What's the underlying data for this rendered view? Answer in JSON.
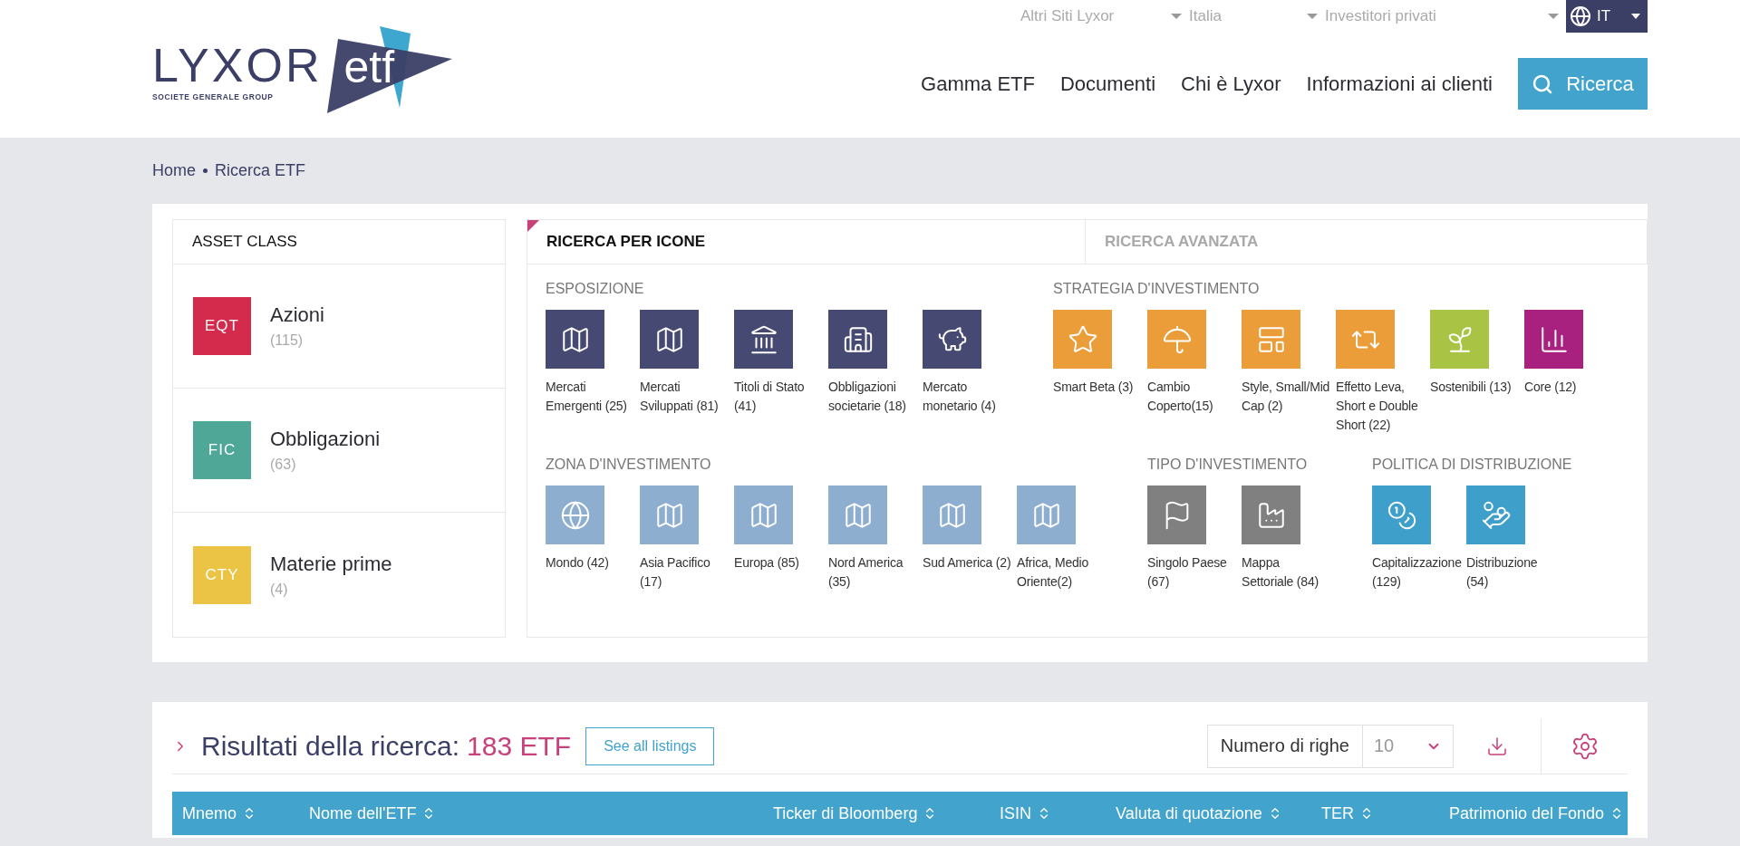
{
  "header": {
    "logo": {
      "name": "LYXOR",
      "tagline": "SOCIETE GENERALE GROUP",
      "mark": "etf"
    },
    "top_selects": [
      "Altri Siti Lyxor",
      "Italia",
      "Investitori privati"
    ],
    "language": "IT",
    "nav": [
      "Gamma ETF",
      "Documenti",
      "Chi è Lyxor",
      "Informazioni ai clienti"
    ],
    "search_button": "Ricerca"
  },
  "breadcrumb": [
    "Home",
    "Ricerca ETF"
  ],
  "asset_class": {
    "title": "ASSET CLASS",
    "items": [
      {
        "code": "EQT",
        "label": "Azioni",
        "count": "(115)",
        "color": "#d42a4c"
      },
      {
        "code": "FIC",
        "label": "Obbligazioni",
        "count": "(63)",
        "color": "#4fa797"
      },
      {
        "code": "CTY",
        "label": "Materie prime",
        "count": "(4)",
        "color": "#ebc445"
      }
    ]
  },
  "search_tabs": [
    {
      "label": "RICERCA PER ICONE",
      "selected": true
    },
    {
      "label": "RICERCA AVANZATA",
      "selected": false
    }
  ],
  "icon_rows": [
    [
      {
        "title": "ESPOSIZIONE",
        "tiles": [
          {
            "label": "Mercati Emergenti (25)",
            "color": "#464a73"
          },
          {
            "label": "Mercati Sviluppati (81)",
            "color": "#464a73"
          },
          {
            "label": "Titoli di Stato (41)",
            "color": "#464a73"
          },
          {
            "label": "Obbligazioni societarie (18)",
            "color": "#464a73"
          },
          {
            "label": "Mercato monetario (4)",
            "color": "#464a73"
          }
        ]
      },
      {
        "title": "STRATEGIA D'INVESTIMENTO",
        "tiles": [
          {
            "label": "Smart Beta (3)",
            "color": "#eb9d3a"
          },
          {
            "label": "Cambio Coperto(15)",
            "color": "#eb9d3a"
          },
          {
            "label": "Style, Small/Mid Cap (2)",
            "color": "#eb9d3a"
          },
          {
            "label": "Effetto Leva, Short e Double Short (22)",
            "color": "#eb9d3a"
          },
          {
            "label": "Sostenibili (13)",
            "color": "#a9c444"
          },
          {
            "label": "Core (12)",
            "color": "#a8217f"
          }
        ]
      }
    ],
    [
      {
        "title": "ZONA D'INVESTIMENTO",
        "tiles": [
          {
            "label": "Mondo (42)",
            "color": "#8eaecf"
          },
          {
            "label": "Asia Pacifico (17)",
            "color": "#8eaecf"
          },
          {
            "label": "Europa (85)",
            "color": "#8eaecf"
          },
          {
            "label": "Nord America (35)",
            "color": "#8eaecf"
          },
          {
            "label": "Sud America (2)",
            "color": "#8eaecf"
          },
          {
            "label": "Africa, Medio Oriente(2)",
            "color": "#8eaecf"
          }
        ]
      },
      {
        "title": "TIPO D'INVESTIMENTO",
        "tiles": [
          {
            "label": "Singolo Paese (67)",
            "color": "#808080"
          },
          {
            "label": "Mappa Settoriale (84)",
            "color": "#808080"
          }
        ]
      },
      {
        "title": "POLITICA DI DISTRIBUZIONE",
        "tiles": [
          {
            "label": "Capitalizzazione (129)",
            "color": "#3e9fcb"
          },
          {
            "label": "Distribuzione (54)",
            "color": "#3e9fcb"
          }
        ]
      }
    ]
  ],
  "results": {
    "title": "Risultati della ricerca:",
    "count": "183 ETF",
    "see_all": "See all listings",
    "rows_label": "Numero di righe",
    "rows_value": "10",
    "columns": [
      "Mnemo",
      "Nome dell'ETF",
      "Ticker di Bloomberg",
      "ISIN",
      "Valuta di quotazione",
      "TER",
      "Patrimonio del Fondo"
    ]
  }
}
